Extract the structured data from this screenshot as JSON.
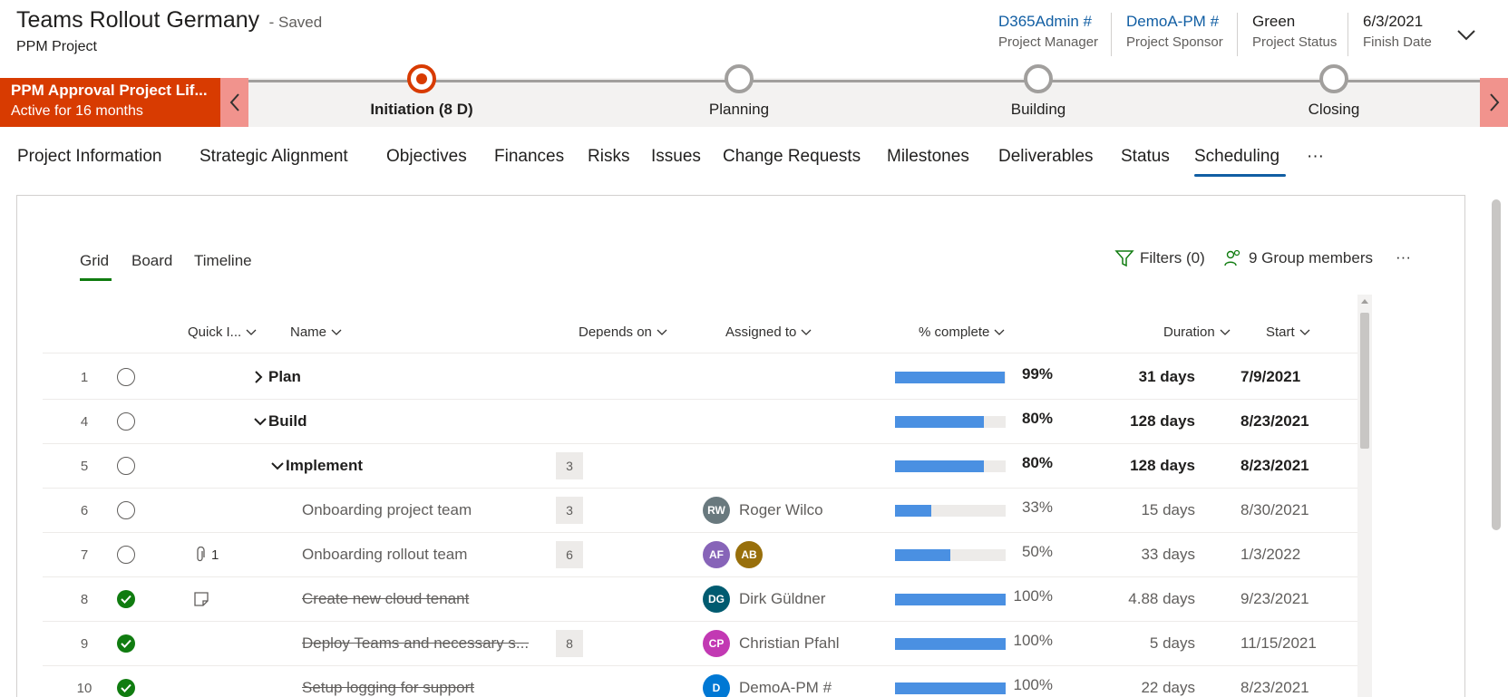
{
  "header": {
    "title": "Teams Rollout Germany",
    "saved": "- Saved",
    "entity": "PPM Project",
    "fields": [
      {
        "value": "D365Admin #",
        "label": "Project Manager"
      },
      {
        "value": "DemoA-PM #",
        "label": "Project Sponsor"
      },
      {
        "value": "Green",
        "label": "Project Status"
      },
      {
        "value": "6/3/2021",
        "label": "Finish Date"
      }
    ]
  },
  "bpf": {
    "name": "PPM Approval Project Lif...",
    "active": "Active for 16 months",
    "stages": [
      {
        "label": "Initiation  (8 D)",
        "active": true
      },
      {
        "label": "Planning",
        "active": false
      },
      {
        "label": "Building",
        "active": false
      },
      {
        "label": "Closing",
        "active": false
      }
    ]
  },
  "tabs": [
    "Project Information",
    "Strategic Alignment",
    "Objectives",
    "Finances",
    "Risks",
    "Issues",
    "Change Requests",
    "Milestones",
    "Deliverables",
    "Status",
    "Scheduling",
    "···"
  ],
  "active_tab": "Scheduling",
  "views": [
    "Grid",
    "Board",
    "Timeline"
  ],
  "toolbar": {
    "filters": "Filters (0)",
    "members": "9 Group members",
    "more": "···"
  },
  "columns": {
    "quick": "Quick I...",
    "name": "Name",
    "depends": "Depends on",
    "assigned": "Assigned to",
    "complete": "% complete",
    "duration": "Duration",
    "start": "Start"
  },
  "rows": [
    {
      "num": "1",
      "done": false,
      "quick": "",
      "name": "Plan",
      "level": 0,
      "expander": "right",
      "summary": true,
      "depends": "",
      "assigned": [],
      "pct": 99,
      "pct_label": "99%",
      "duration": "31 days",
      "start": "7/9/2021"
    },
    {
      "num": "4",
      "done": false,
      "quick": "",
      "name": "Build",
      "level": 0,
      "expander": "down",
      "summary": true,
      "depends": "",
      "assigned": [],
      "pct": 80,
      "pct_label": "80%",
      "duration": "128 days",
      "start": "8/23/2021"
    },
    {
      "num": "5",
      "done": false,
      "quick": "",
      "name": "Implement",
      "level": 1,
      "expander": "down",
      "summary": true,
      "depends": "3",
      "assigned": [],
      "pct": 80,
      "pct_label": "80%",
      "duration": "128 days",
      "start": "8/23/2021"
    },
    {
      "num": "6",
      "done": false,
      "quick": "",
      "name": "Onboarding project team",
      "level": 2,
      "expander": "",
      "summary": false,
      "depends": "3",
      "assigned": [
        {
          "initials": "RW",
          "color": "#69797e",
          "name": "Roger Wilco"
        }
      ],
      "pct": 33,
      "pct_label": "33%",
      "duration": "15 days",
      "start": "8/30/2021"
    },
    {
      "num": "7",
      "done": false,
      "quick": "attach",
      "quick_count": "1",
      "name": "Onboarding rollout team",
      "level": 2,
      "expander": "",
      "summary": false,
      "depends": "6",
      "assigned": [
        {
          "initials": "AF",
          "color": "#8764b8",
          "name": ""
        },
        {
          "initials": "AB",
          "color": "#986f0b",
          "name": ""
        }
      ],
      "pct": 50,
      "pct_label": "50%",
      "duration": "33 days",
      "start": "1/3/2022"
    },
    {
      "num": "8",
      "done": true,
      "quick": "note",
      "name": "Create new cloud tenant",
      "level": 2,
      "expander": "",
      "summary": false,
      "depends": "",
      "assigned": [
        {
          "initials": "DG",
          "color": "#005b70",
          "name": "Dirk Güldner"
        }
      ],
      "pct": 100,
      "pct_label": "100%",
      "duration": "4.88 days",
      "start": "9/23/2021"
    },
    {
      "num": "9",
      "done": true,
      "quick": "",
      "name": "Deploy Teams and necessary s...",
      "level": 2,
      "expander": "",
      "summary": false,
      "depends": "8",
      "assigned": [
        {
          "initials": "CP",
          "color": "#c239b3",
          "name": "Christian Pfahl"
        }
      ],
      "pct": 100,
      "pct_label": "100%",
      "duration": "5 days",
      "start": "11/15/2021"
    },
    {
      "num": "10",
      "done": true,
      "quick": "",
      "name": "Setup logging for support",
      "level": 2,
      "expander": "",
      "summary": false,
      "depends": "",
      "assigned": [
        {
          "initials": "D",
          "color": "#0078d4",
          "name": "DemoA-PM #"
        }
      ],
      "pct": 100,
      "pct_label": "100%",
      "duration": "22 days",
      "start": "8/23/2021"
    }
  ]
}
